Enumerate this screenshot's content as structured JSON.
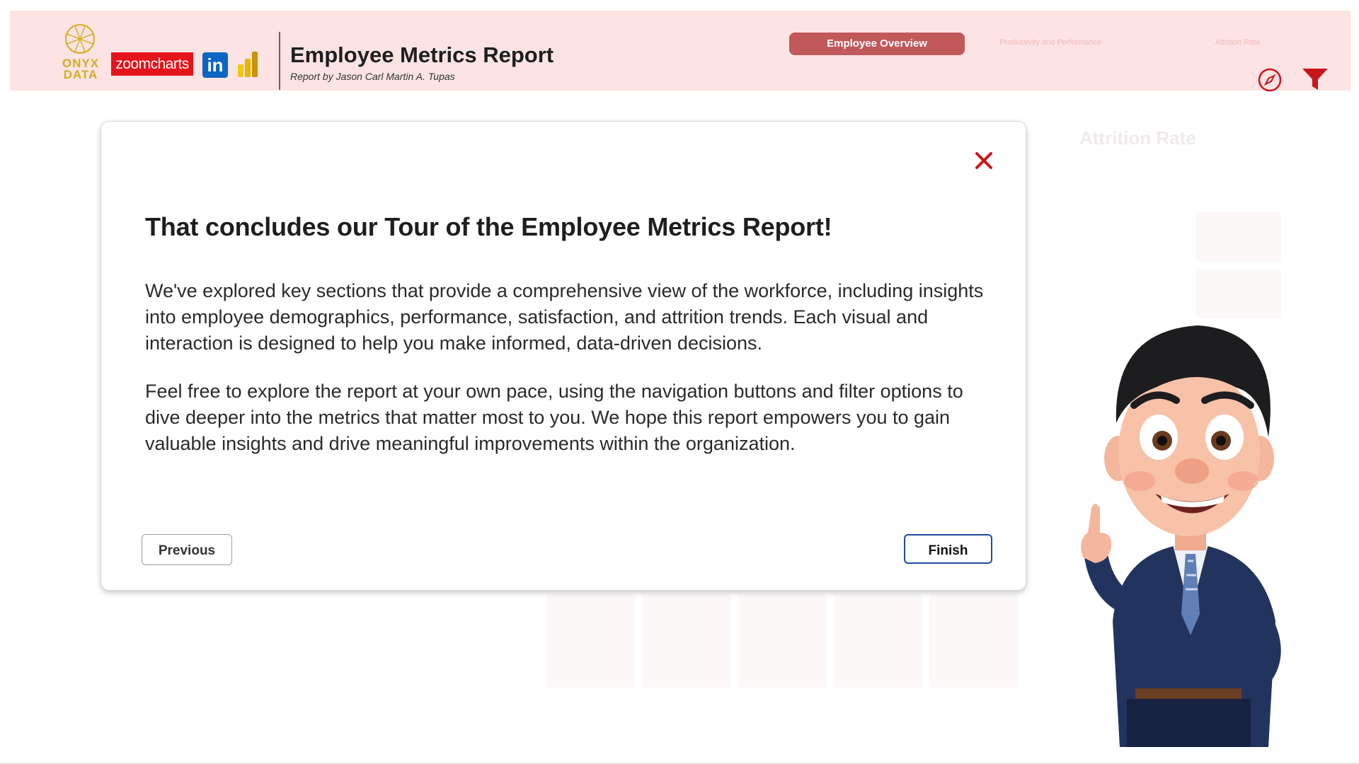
{
  "header": {
    "logos": {
      "onyx_line1": "ONYX",
      "onyx_line2": "DATA",
      "zoomcharts": "zoomcharts",
      "linkedin": "in"
    },
    "title": "Employee Metrics Report",
    "subtitle": "Report by Jason Carl Martin A. Tupas",
    "tabs": [
      {
        "label": "Employee Overview",
        "active": true
      },
      {
        "label": "Productivity and Performance",
        "active": false
      },
      {
        "label": "Attrition Rate",
        "active": false
      }
    ],
    "icons": [
      "compass-icon",
      "filter-icon"
    ]
  },
  "background": {
    "card_title": "Attrition Rate"
  },
  "modal": {
    "heading": "That concludes our Tour of the Employee Metrics Report!",
    "paragraph_1": "We've explored key sections that provide a comprehensive view of the workforce, including insights into employee demographics, performance, satisfaction, and attrition trends. Each visual and interaction is designed to help you make informed, data-driven decisions.",
    "paragraph_2": "Feel free to explore the report at your own pace, using the navigation buttons and filter options to dive deeper into the metrics that matter most to you. We hope this report empowers you to gain valuable insights and drive meaningful improvements within the organization.",
    "previous_label": "Previous",
    "finish_label": "Finish"
  },
  "colors": {
    "header_bg": "#fde3e3",
    "active_tab": "#c0585c",
    "close_red": "#c8161d",
    "finish_border": "#1f4e9a"
  }
}
